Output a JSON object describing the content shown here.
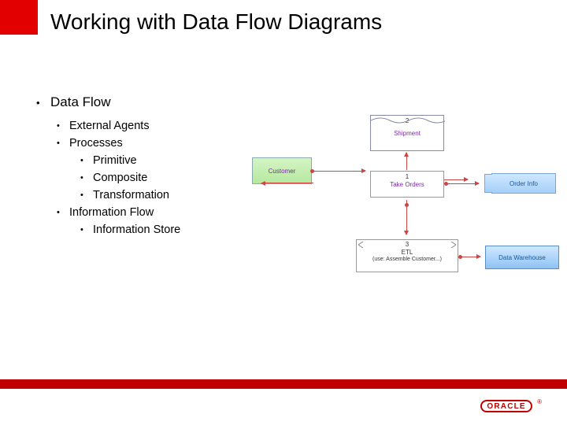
{
  "title": "Working with Data Flow Diagrams",
  "bullets": {
    "l1": "Data Flow",
    "l2a": "External Agents",
    "l2b": "Processes",
    "l3a": "Primitive",
    "l3b": "Composite",
    "l3c": "Transformation",
    "l2c": "Information Flow",
    "l3d": "Information Store"
  },
  "diagram": {
    "shipment": {
      "num": "2",
      "label": "Shipment"
    },
    "customer": {
      "label": "Customer"
    },
    "take_orders": {
      "num": "1",
      "label": "Take Orders"
    },
    "order_info": {
      "label": "Order Info"
    },
    "etl": {
      "num": "3",
      "line1": "ETL",
      "line2": "(use: Assemble Customer...)"
    },
    "data_warehouse": {
      "label": "Data Warehouse"
    }
  },
  "footer": {
    "logo_text": "ORACLE",
    "reg": "®"
  }
}
